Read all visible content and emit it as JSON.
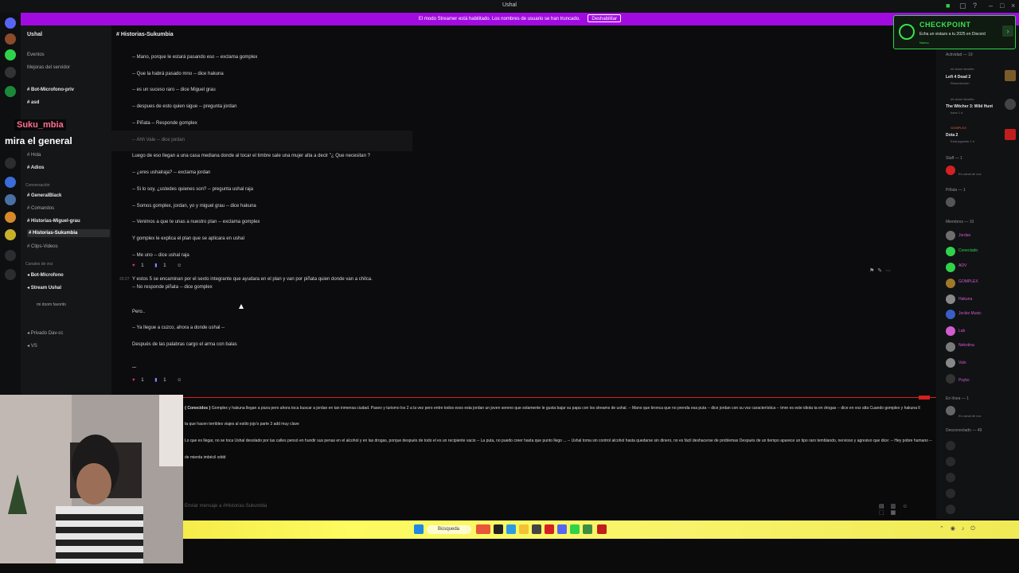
{
  "window": {
    "title": "Ushal"
  },
  "banner": {
    "text": "El modo Streamer está habilitado. Los nombres de usuario se han truncado.",
    "button": "Deshabilitar"
  },
  "server": {
    "name": "Ushal",
    "items": [
      "Eventos",
      "Mejoras del servidor"
    ],
    "channels_top": [
      "Bot-Microfono-priv",
      "asd",
      "Hola",
      "Adios"
    ],
    "category_conversations": "Conversación",
    "channels_conv": [
      "GeneralBlack",
      "Comandos",
      "Historias-Miguel-grau",
      "Historias-Sukumbia",
      "Clips-Videos"
    ],
    "category_voice": "Canales de voz",
    "voice": [
      "Bot-Microfono",
      "Stream Ushal",
      "Privado Dav-cc",
      "VS"
    ],
    "voice_sub": "mi doom favorito"
  },
  "chat": {
    "channel": "Historias-Sukumbia",
    "lines": [
      "-- Mano, porque le estará pasando eso -- exclama gomplex",
      "-- Que la habrá pasado mno -- dice hakuna",
      "-- es un suceso raro -- dice Miguel grau",
      "-- despues de esto quien sigue -- pregunta jordan",
      "-- Piñata -- Responde gomplex",
      "-- Ahh Vale -- dice jordan",
      "Luego de eso llegan a una casa mediana donde al tocar el timbre sale una mujer alta a decir \"¿ Que necesitan ?",
      "-- ¿eres ushalraja? -- exclama jordan",
      "-- Si lo soy, ¿ustedes quienes son? -- pregunta ushal raja",
      "-- Somos gomplex, jordan, yo y miguel grau -- dice hakuna",
      "-- Venimos a que te unas a nuestro plan -- exclama gomplex",
      "Y gomplex le explica el plan que se aplicara en ushal",
      "-- Me uno -- dice ushal raja"
    ],
    "msg2_time": "20:27",
    "msg2_lines": [
      "Y estos 5 se encaminan por el sexto integrante que ayudara en el plan y van por piñata quien donde van a chilca.",
      "-- No responde piñata -- dice gomplex",
      "Pero..",
      "-- Ya llegue a cuzco, ahora a donde ushal --",
      "Después de las palabras cargo el arma con balas",
      "..."
    ],
    "react_count": "1",
    "input_placeholder": "Enviar mensaje a #Historias-Sukumbia"
  },
  "overlay": {
    "user": "Suku_mbia",
    "message": "mira el general"
  },
  "checkpoint": {
    "title": "CHECKPOINT",
    "subtitle": "Echa un vistazo a tu 2025 en Discord",
    "small": "Nuevo"
  },
  "right": {
    "activity_header": "Actividad — 19",
    "activities": [
      {
        "name": "mi doom favorito",
        "game": "Left 4 Dead 2",
        "sub": "Resurrección"
      },
      {
        "name": "mi doom favorito",
        "game": "The Witcher 3: Wild Hunt",
        "sub": "hace 1 d"
      },
      {
        "name": "GOMPLEX",
        "game": "Dota 2",
        "sub": "Está jugando 1 h"
      }
    ],
    "staff_header": "Staff — 1",
    "staff_sub": "En canal de voz",
    "pinata_header": "Piñata — 1",
    "members_header": "Miembros — 10",
    "members": [
      "Jordan",
      "Conectado",
      "ADV",
      "GOMPLEX",
      "Hakuna",
      "Jockie Music",
      "Lab",
      "Nekotina",
      "Valo",
      "Psyko"
    ],
    "online_header": "En línea — 1",
    "online_sub": "En canal de voz",
    "offline_header": "Desconectado — 49"
  },
  "lyrics": {
    "header": "{ Conocidos }",
    "line1": "Gomplex y hakuna llegan a piura pero ahora toca buscar a jordan en tan inmensa ciudad. Paseo y turismo los 2 a la vez pero entre todos esos esta jordan un joven sereno que solamente le gusta bajar su papa con los streams de ushal. -- Mano que bronca que no prenda esa puta -- dice jordan con su voz característica -- tmre es este idiota ta en drogas -- dice en voz alta  Cuando gomplex y hakuna ll",
    "line2": "ta que hacen terribles viajes al estilo jojo's parte 3 add muy clave",
    "line3": "Lo que es llegar, no se toca  Ushal desolado por las calles pensó en hundir sus penas en el alcohol y en las drogas, porque después de todo el es un recipiente vacio -- La puta, no puedo creer hasta que punto llego ... -- Ushal toma sin control alcohol hasta quedarse sin dinero, no es fácil deshacerse de problemas  Después de un tiempo aparece un tipo raro temblando, nervioso y agresivo que dice: -- Hey pobre humano --",
    "line4": "de mierda imbécil xddd"
  },
  "taskbar": {
    "search": "Búsqueda"
  },
  "colors": {
    "accent": "#a20be0",
    "checkpoint": "#39e34f",
    "taskbar": "#f8f36a",
    "live": "#d42020"
  }
}
